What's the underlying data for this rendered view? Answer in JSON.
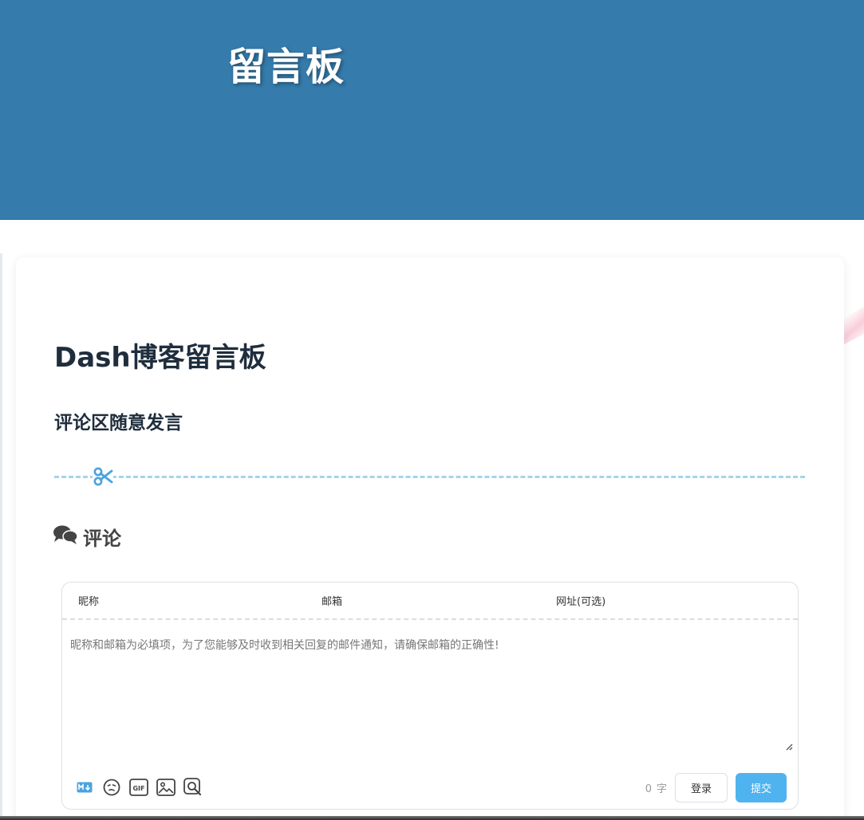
{
  "hero": {
    "title": "留言板"
  },
  "page": {
    "title": "Dash博客留言板",
    "subtitle": "评论区随意发言"
  },
  "comments": {
    "heading": "评论",
    "fields": {
      "nickname_placeholder": "昵称",
      "email_placeholder": "邮箱",
      "website_placeholder": "网址(可选)"
    },
    "textarea_placeholder": "昵称和邮箱为必填项，为了您能够及时收到相关回复的邮件通知，请确保邮箱的正确性!",
    "word_count": "0",
    "word_unit": "字",
    "login_label": "登录",
    "submit_label": "提交",
    "toolbar_icons": [
      "markdown-icon",
      "emoji-icon",
      "gif-icon",
      "image-icon",
      "preview-icon"
    ]
  },
  "colors": {
    "hero_bg": "#357bab",
    "divider": "#a5d4ec",
    "accent": "#4fb3ef",
    "icon": "#4aa3df"
  }
}
